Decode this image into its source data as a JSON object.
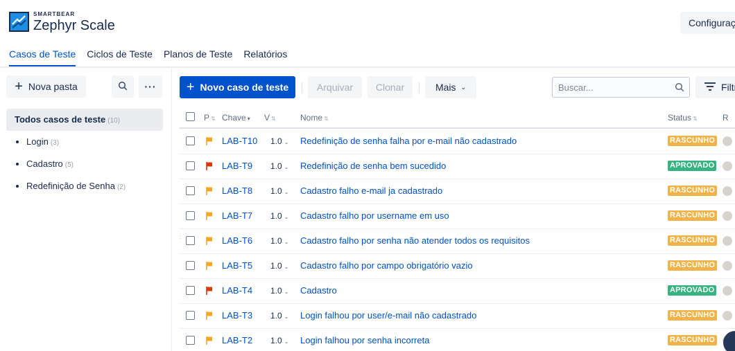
{
  "header": {
    "brand_small": "SMARTBEAR",
    "brand_name": "Zephyr Scale",
    "config_label": "Configurações",
    "brand_color": "#0065ff"
  },
  "tabs": [
    {
      "label": "Casos de Teste",
      "active": true
    },
    {
      "label": "Ciclos de Teste",
      "active": false
    },
    {
      "label": "Planos de Teste",
      "active": false
    },
    {
      "label": "Relatórios",
      "active": false
    }
  ],
  "sidebar": {
    "new_folder_label": "Nova pasta",
    "search_icon": "search-icon",
    "more_label": "···",
    "root": {
      "label": "Todos casos de teste",
      "count": "(10)"
    },
    "folders": [
      {
        "label": "Login",
        "count": "(3)"
      },
      {
        "label": "Cadastro",
        "count": "(5)"
      },
      {
        "label": "Redefinição de Senha",
        "count": "(2)"
      }
    ]
  },
  "toolbar": {
    "new_case_label": "Novo caso de teste",
    "archive_label": "Arquivar",
    "clone_label": "Clonar",
    "more_label": "Mais",
    "search_placeholder": "Buscar...",
    "filter_label": "Filtros"
  },
  "table": {
    "columns": {
      "priority": "P",
      "key": "Chave",
      "version": "V",
      "name": "Nome",
      "status": "Status",
      "owner": "R"
    },
    "rows": [
      {
        "key": "LAB-T10",
        "version": "1.0",
        "name": "Redefinição de senha falha por e-mail não cadastrado",
        "status": "RASCUNHO",
        "priority": "normal"
      },
      {
        "key": "LAB-T9",
        "version": "1.0",
        "name": "Redefinição de senha bem sucedido",
        "status": "APROVADO",
        "priority": "high"
      },
      {
        "key": "LAB-T8",
        "version": "1.0",
        "name": "Cadastro falho e-mail ja cadastrado",
        "status": "RASCUNHO",
        "priority": "normal"
      },
      {
        "key": "LAB-T7",
        "version": "1.0",
        "name": "Cadastro falho por username em uso",
        "status": "RASCUNHO",
        "priority": "normal"
      },
      {
        "key": "LAB-T6",
        "version": "1.0",
        "name": "Cadastro falho por senha não atender todos os requisitos",
        "status": "RASCUNHO",
        "priority": "normal"
      },
      {
        "key": "LAB-T5",
        "version": "1.0",
        "name": "Cadastro falho por campo obrigatório vazio",
        "status": "RASCUNHO",
        "priority": "normal"
      },
      {
        "key": "LAB-T4",
        "version": "1.0",
        "name": "Cadastro",
        "status": "APROVADO",
        "priority": "high"
      },
      {
        "key": "LAB-T3",
        "version": "1.0",
        "name": "Login falhou por user/e-mail não cadastrado",
        "status": "RASCUNHO",
        "priority": "normal"
      },
      {
        "key": "LAB-T2",
        "version": "1.0",
        "name": "Login falhou por senha incorreta",
        "status": "RASCUNHO",
        "priority": "normal"
      }
    ]
  },
  "colors": {
    "primary": "#0052cc",
    "status_draft": "#f0b34a",
    "status_approved": "#36b37e",
    "priority_normal": "#f5a623",
    "priority_high": "#de350b"
  }
}
